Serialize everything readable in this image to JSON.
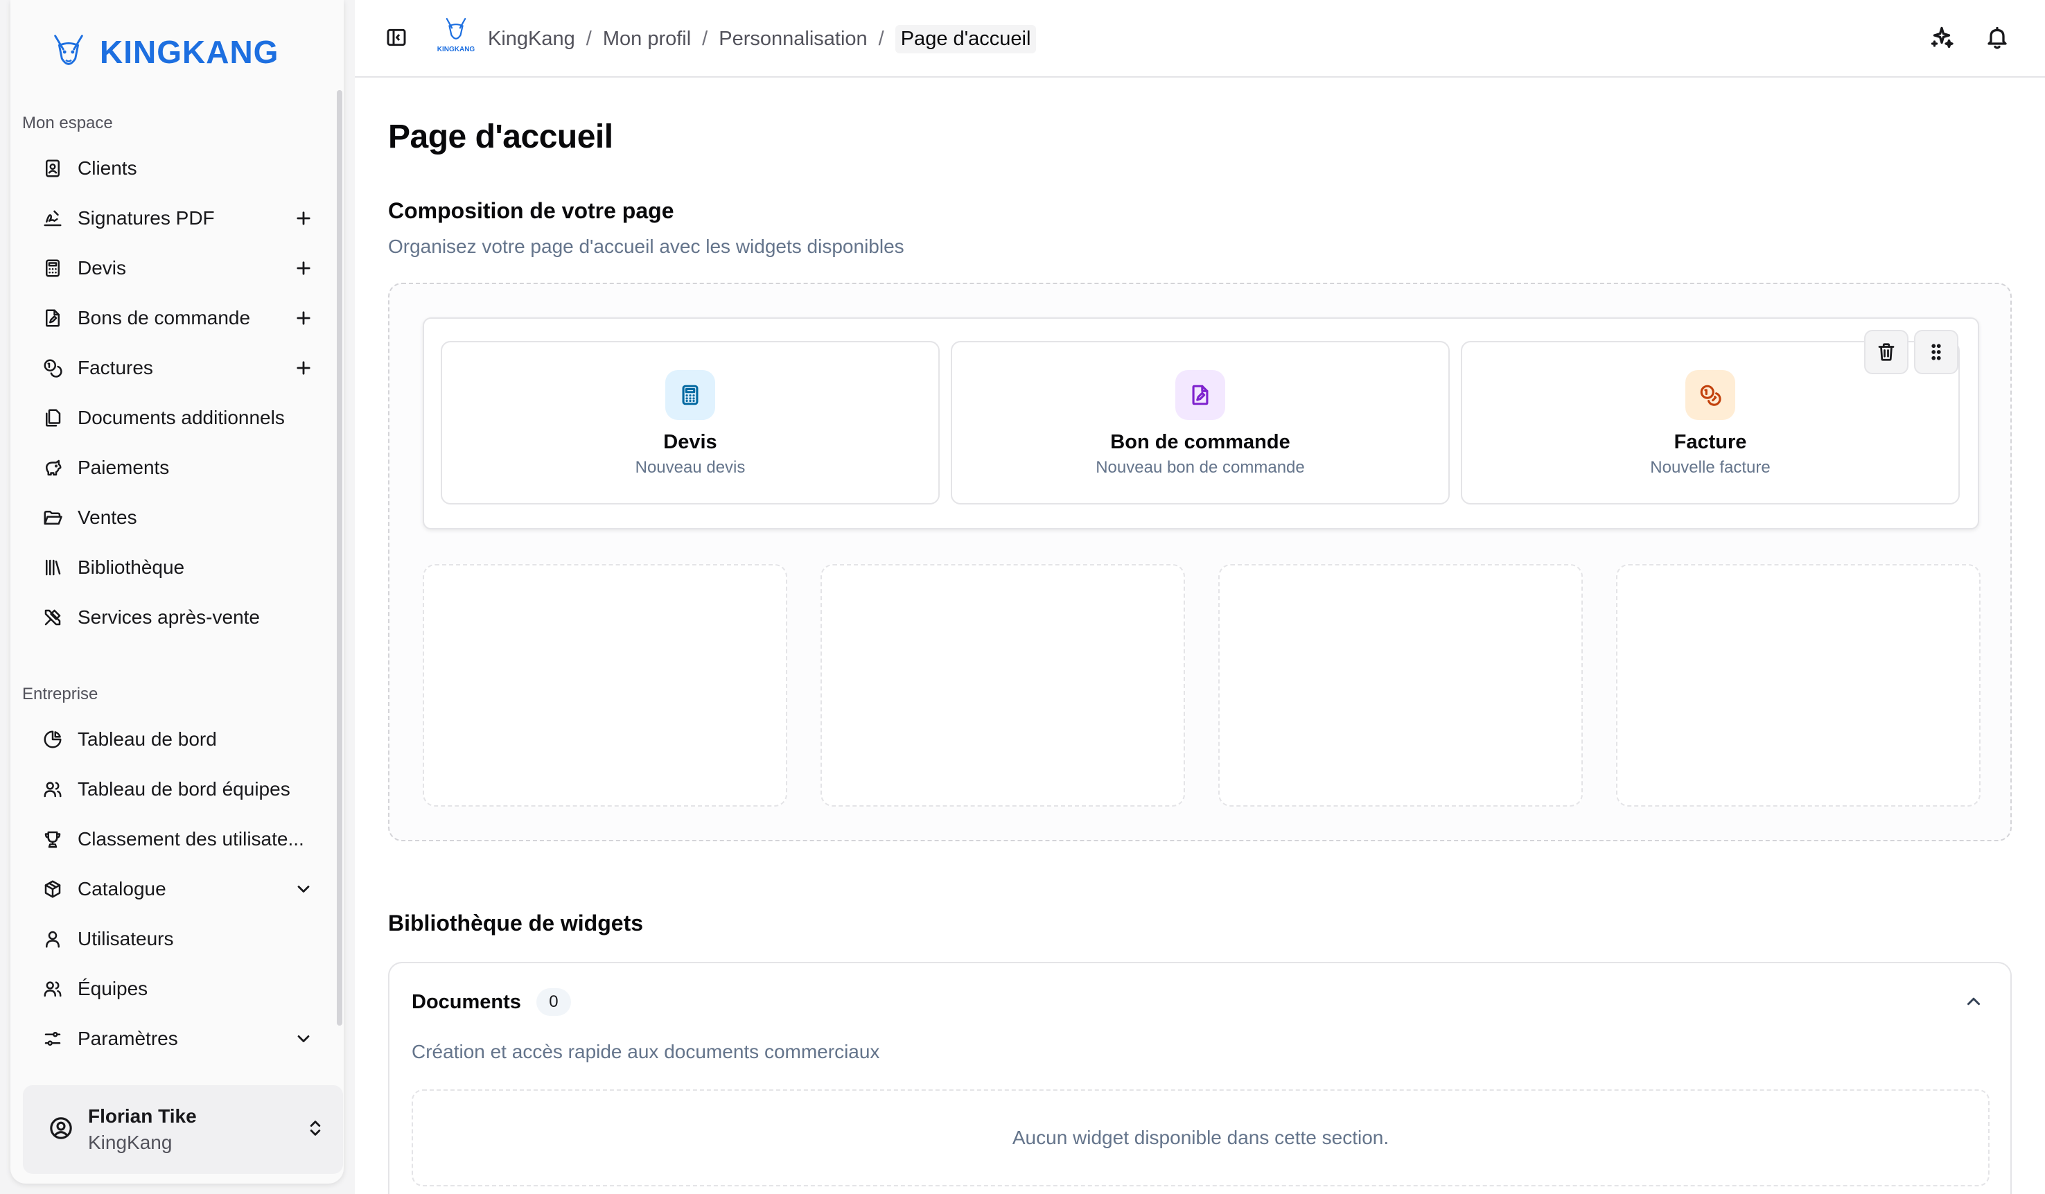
{
  "brand": {
    "name": "KINGKANG",
    "mini": "KINGKANG"
  },
  "sidebar": {
    "section_personal": "Mon espace",
    "personal_items": [
      {
        "label": "Clients",
        "icon": "contact-icon",
        "trail": ""
      },
      {
        "label": "Signatures PDF",
        "icon": "signature-icon",
        "trail": "plus-icon"
      },
      {
        "label": "Devis",
        "icon": "calculator-icon",
        "trail": "plus-icon"
      },
      {
        "label": "Bons de commande",
        "icon": "file-signature-icon",
        "trail": "plus-icon"
      },
      {
        "label": "Factures",
        "icon": "coins-icon",
        "trail": "plus-icon"
      },
      {
        "label": "Documents additionnels",
        "icon": "files-icon",
        "trail": ""
      },
      {
        "label": "Paiements",
        "icon": "piggy-bank-icon",
        "trail": ""
      },
      {
        "label": "Ventes",
        "icon": "folder-open-icon",
        "trail": ""
      },
      {
        "label": "Bibliothèque",
        "icon": "library-icon",
        "trail": ""
      },
      {
        "label": "Services après-vente",
        "icon": "tools-icon",
        "trail": ""
      }
    ],
    "section_company": "Entreprise",
    "company_items": [
      {
        "label": "Tableau de bord",
        "icon": "pie-chart-icon",
        "trail": ""
      },
      {
        "label": "Tableau de bord équipes",
        "icon": "users-icon",
        "trail": ""
      },
      {
        "label": "Classement des utilisate...",
        "icon": "trophy-icon",
        "trail": ""
      },
      {
        "label": "Catalogue",
        "icon": "package-icon",
        "trail": "chevron-down-icon"
      },
      {
        "label": "Utilisateurs",
        "icon": "user-icon",
        "trail": ""
      },
      {
        "label": "Équipes",
        "icon": "users-icon",
        "trail": ""
      },
      {
        "label": "Paramètres",
        "icon": "settings-sliders-icon",
        "trail": "chevron-down-icon"
      }
    ],
    "user": {
      "name": "Florian Tike",
      "company": "KingKang"
    }
  },
  "breadcrumb": {
    "items": [
      "KingKang",
      "Mon profil",
      "Personnalisation"
    ],
    "current": "Page d'accueil"
  },
  "page": {
    "title": "Page d'accueil",
    "composition_title": "Composition de votre page",
    "composition_subtitle": "Organisez votre page d'accueil avec les widgets disponibles",
    "widgets": [
      {
        "title": "Devis",
        "desc": "Nouveau devis",
        "icon": "calculator-icon",
        "bg": "#e0f2fe",
        "color": "#0369a1"
      },
      {
        "title": "Bon de commande",
        "desc": "Nouveau bon de commande",
        "icon": "file-signature-icon",
        "bg": "#f3e8ff",
        "color": "#7e22ce"
      },
      {
        "title": "Facture",
        "desc": "Nouvelle facture",
        "icon": "coins-icon",
        "bg": "#ffedd5",
        "color": "#c2410c"
      }
    ],
    "library_title": "Bibliothèque de widgets",
    "library": {
      "section": "Documents",
      "count": "0",
      "description": "Création et accès rapide aux documents commerciaux",
      "empty": "Aucun widget disponible dans cette section."
    }
  },
  "colors": {
    "brand": "#1d6fe0"
  }
}
